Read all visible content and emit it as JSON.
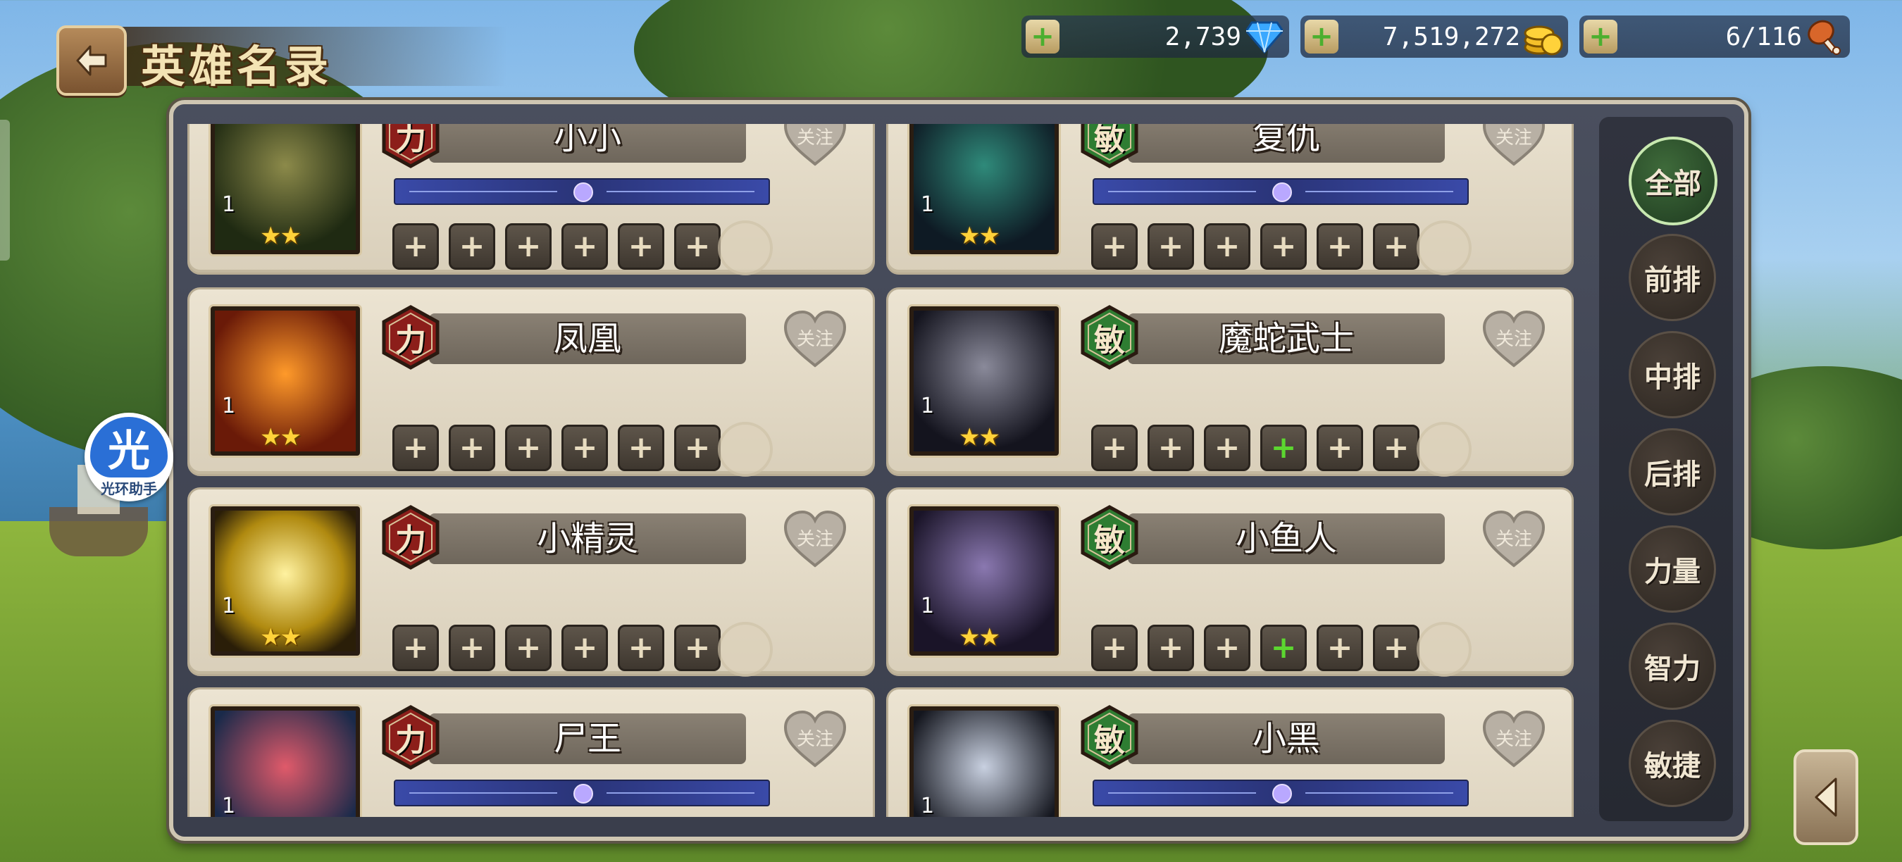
{
  "header": {
    "title": "英雄名录",
    "back_icon": "back-arrow-icon"
  },
  "resources": [
    {
      "name": "diamonds",
      "value": "2,739",
      "icon": "diamond-icon",
      "plus_label": "+"
    },
    {
      "name": "gold",
      "value": "7,519,272",
      "icon": "gold-coins-icon",
      "plus_label": "+"
    },
    {
      "name": "stamina",
      "value": "6/116",
      "icon": "drumstick-icon",
      "plus_label": "+"
    }
  ],
  "slot_plus": "+",
  "heroes": [
    {
      "name": "小小",
      "attr": "力",
      "attr_type": "strength",
      "level": "1",
      "stars": "★★",
      "fav_label": "关注",
      "show_progress": true,
      "green_slot": -1
    },
    {
      "name": "复仇",
      "attr": "敏",
      "attr_type": "agility",
      "level": "1",
      "stars": "★★",
      "fav_label": "关注",
      "show_progress": true,
      "green_slot": -1
    },
    {
      "name": "凤凰",
      "attr": "力",
      "attr_type": "strength",
      "level": "1",
      "stars": "★★",
      "fav_label": "关注",
      "show_progress": false,
      "green_slot": -1
    },
    {
      "name": "魔蛇武士",
      "attr": "敏",
      "attr_type": "agility",
      "level": "1",
      "stars": "★★",
      "fav_label": "关注",
      "show_progress": false,
      "green_slot": 3
    },
    {
      "name": "小精灵",
      "attr": "力",
      "attr_type": "strength",
      "level": "1",
      "stars": "★★",
      "fav_label": "关注",
      "show_progress": false,
      "green_slot": -1
    },
    {
      "name": "小鱼人",
      "attr": "敏",
      "attr_type": "agility",
      "level": "1",
      "stars": "★★",
      "fav_label": "关注",
      "show_progress": false,
      "green_slot": 3
    },
    {
      "name": "尸王",
      "attr": "力",
      "attr_type": "strength",
      "level": "1",
      "stars": "",
      "fav_label": "关注",
      "show_progress": true,
      "green_slot": 5
    },
    {
      "name": "小黑",
      "attr": "敏",
      "attr_type": "agility",
      "level": "1",
      "stars": "",
      "fav_label": "关注",
      "show_progress": true,
      "green_slot": -1
    }
  ],
  "filters": [
    {
      "label": "全部",
      "active": true
    },
    {
      "label": "前排",
      "active": false
    },
    {
      "label": "中排",
      "active": false
    },
    {
      "label": "后排",
      "active": false
    },
    {
      "label": "力量",
      "active": false
    },
    {
      "label": "智力",
      "active": false
    },
    {
      "label": "敏捷",
      "active": false
    }
  ],
  "helper": {
    "icon_text": "光",
    "label": "光环助手"
  },
  "colors": {
    "strength_badge": "#8c1e1a",
    "agility_badge": "#2e7d32",
    "accent_gold": "#ffd23a",
    "slot_green": "#5cd630"
  }
}
